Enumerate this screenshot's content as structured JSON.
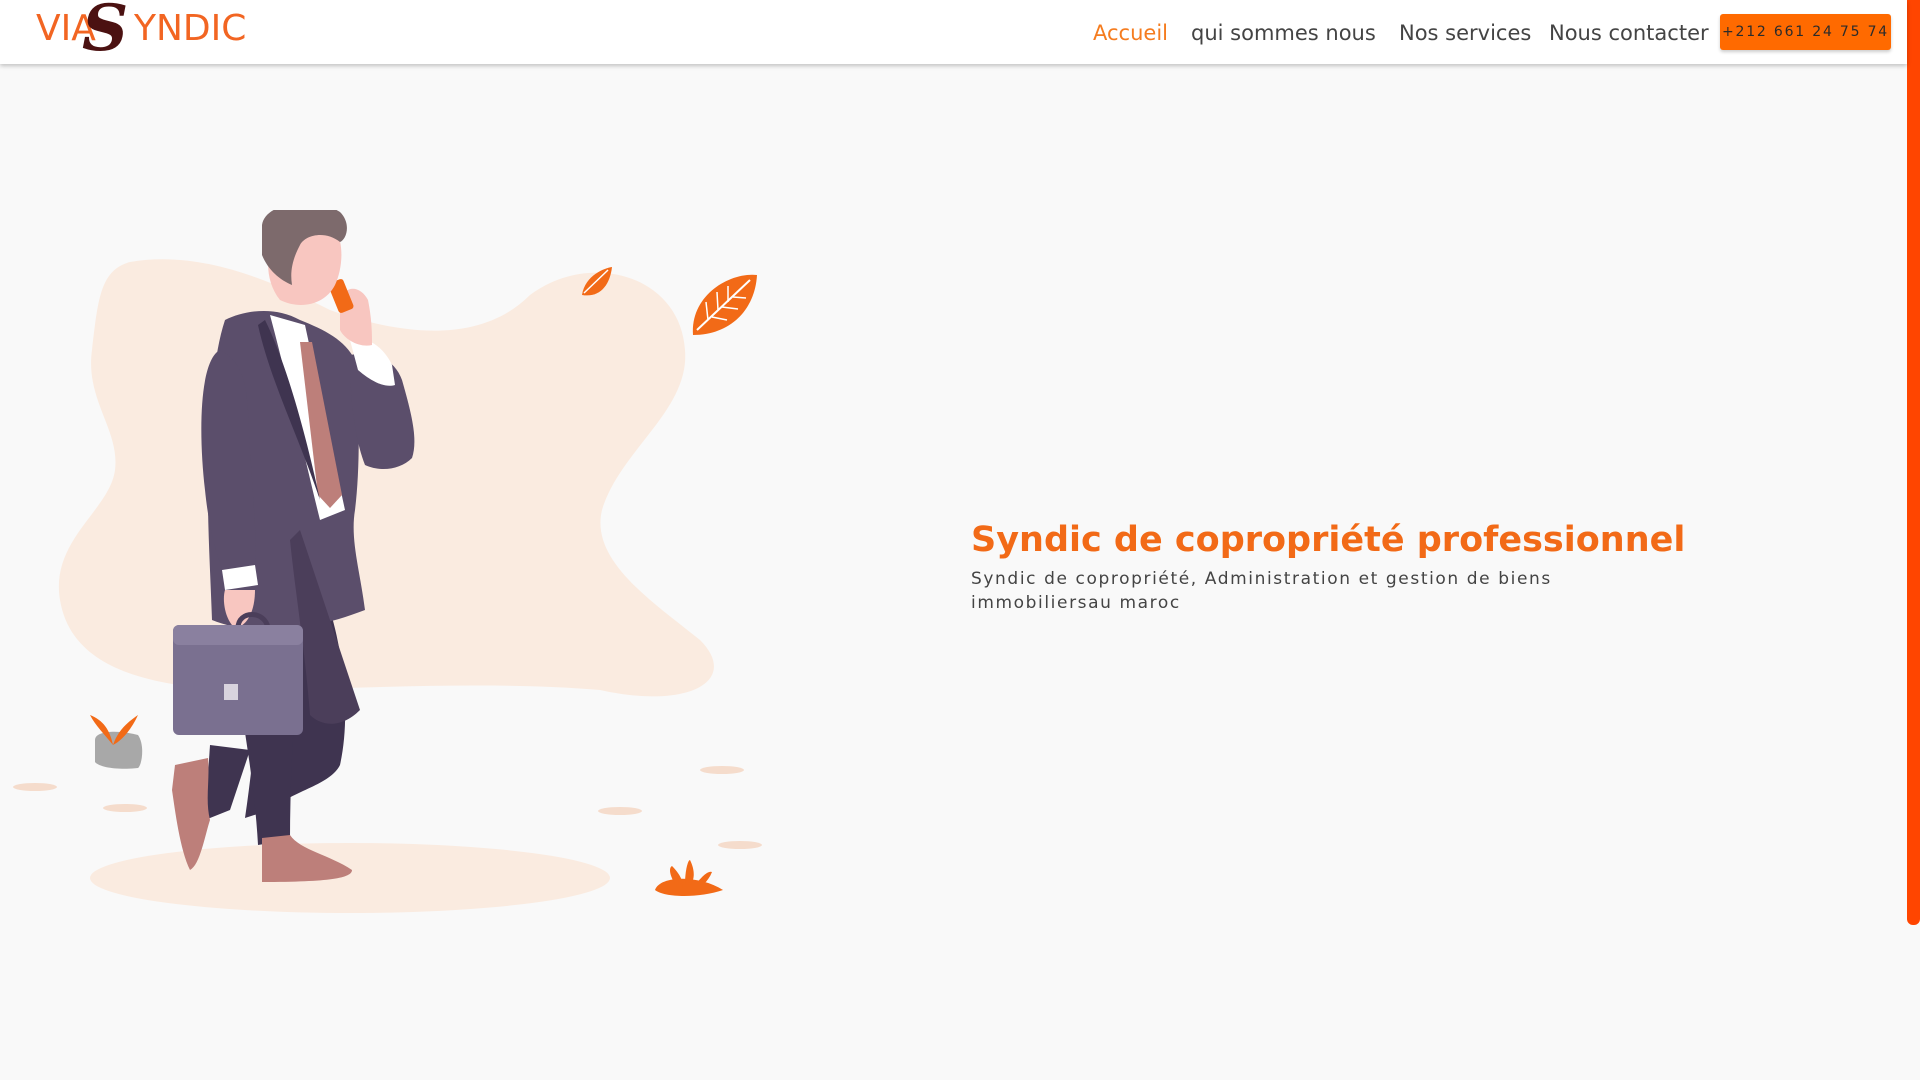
{
  "brand": {
    "logo_prefix": "VIA",
    "logo_s": "S",
    "logo_suffix": "YNDIC"
  },
  "nav": {
    "items": [
      {
        "label": "Accueil",
        "active": true
      },
      {
        "label": "qui sommes nous",
        "active": false
      },
      {
        "label": "Nos services",
        "active": false
      },
      {
        "label": "Nous contacter",
        "active": false
      }
    ],
    "phone_button": "+212 661 24 75 74"
  },
  "hero": {
    "title": "Syndic de copropriété professionnel",
    "subtitle": "Syndic de copropriété, Administration et gestion de biens immobiliersau maroc"
  },
  "colors": {
    "accent": "#f26a17",
    "button": "#ff6a00",
    "logo_s": "#4b1111",
    "blob": "#faebe0",
    "suit": "#5b4e6b"
  },
  "illustration": {
    "subject": "businessman-with-phone-and-briefcase"
  }
}
